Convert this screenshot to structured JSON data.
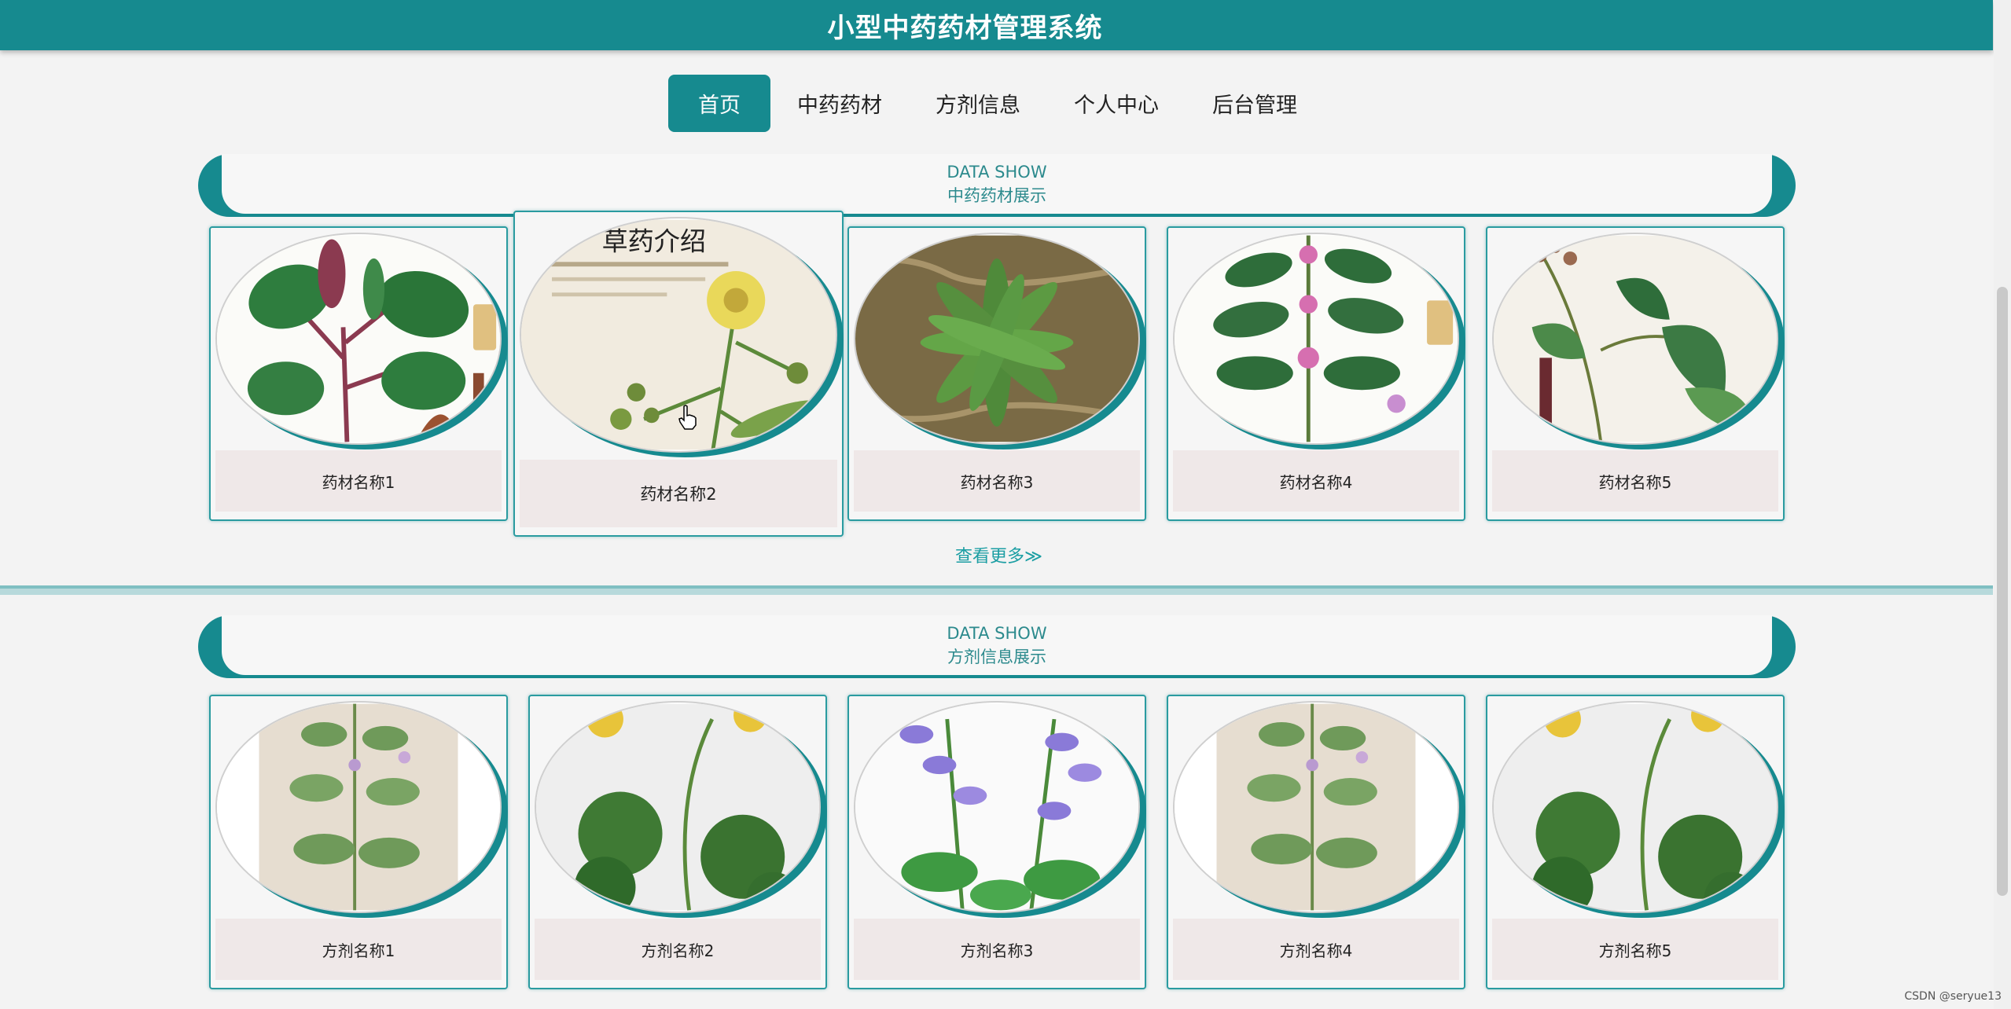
{
  "header": {
    "title": "小型中药药材管理系统"
  },
  "nav": {
    "items": [
      {
        "label": "首页",
        "active": true
      },
      {
        "label": "中药药材",
        "active": false
      },
      {
        "label": "方剂信息",
        "active": false
      },
      {
        "label": "个人中心",
        "active": false
      },
      {
        "label": "后台管理",
        "active": false
      }
    ]
  },
  "herbs_section": {
    "title_en": "DATA SHOW",
    "title_cn": "中药药材展示",
    "cards": [
      {
        "name": "药材名称1"
      },
      {
        "name": "药材名称2",
        "image_text": "草药介绍"
      },
      {
        "name": "药材名称3"
      },
      {
        "name": "药材名称4"
      },
      {
        "name": "药材名称5"
      }
    ],
    "more_label": "查看更多≫"
  },
  "formula_section": {
    "title_en": "DATA SHOW",
    "title_cn": "方剂信息展示",
    "cards": [
      {
        "name": "方剂名称1"
      },
      {
        "name": "方剂名称2"
      },
      {
        "name": "方剂名称3"
      },
      {
        "name": "方剂名称4"
      },
      {
        "name": "方剂名称5"
      }
    ]
  },
  "watermark": "CSDN @seryue13",
  "colors": {
    "primary": "#168a8f",
    "label_bg": "#efe8e8",
    "page_bg": "#f3f3f3"
  }
}
